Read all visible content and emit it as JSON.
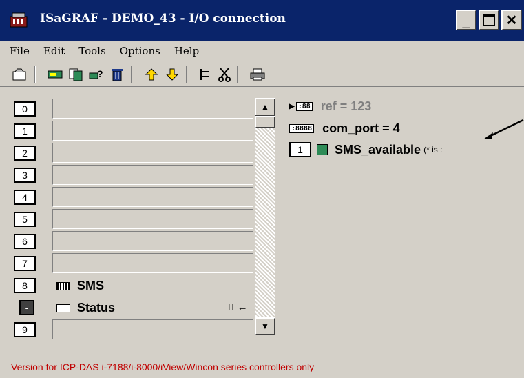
{
  "window": {
    "title": "ISaGRAF - DEMO_43 - I/O connection",
    "min_label": "_",
    "max_label": "□",
    "close_label": "✕"
  },
  "menu": [
    "File",
    "Edit",
    "Tools",
    "Options",
    "Help"
  ],
  "toolbar": {
    "icons": [
      "open-icon",
      "board-icon",
      "copy-icon",
      "params-icon",
      "delete-icon",
      "arrow-up-icon",
      "arrow-down-icon",
      "tree-icon",
      "cut-icon",
      "print-icon"
    ]
  },
  "slots": [
    {
      "label": "0"
    },
    {
      "label": "1"
    },
    {
      "label": "2"
    },
    {
      "label": "3"
    },
    {
      "label": "4"
    },
    {
      "label": "5"
    },
    {
      "label": "6"
    },
    {
      "label": "7"
    },
    {
      "label": "8",
      "board": "SMS"
    },
    {
      "label": "-",
      "board": "Status",
      "suffix": "⎍ ←"
    },
    {
      "label": "9"
    }
  ],
  "variables": {
    "ref": "ref = 123",
    "com_port": "com_port = 4",
    "channel": "1",
    "sms_available": "SMS_available",
    "sms_comment": "(* is :"
  },
  "status": {
    "text": "Version for ICP-DAS i-7188/i-8000/iView/Wincon series controllers only"
  },
  "colors": {
    "titlebar": "#0a246a",
    "status_text": "#c00000",
    "face": "#d4d0c8"
  }
}
